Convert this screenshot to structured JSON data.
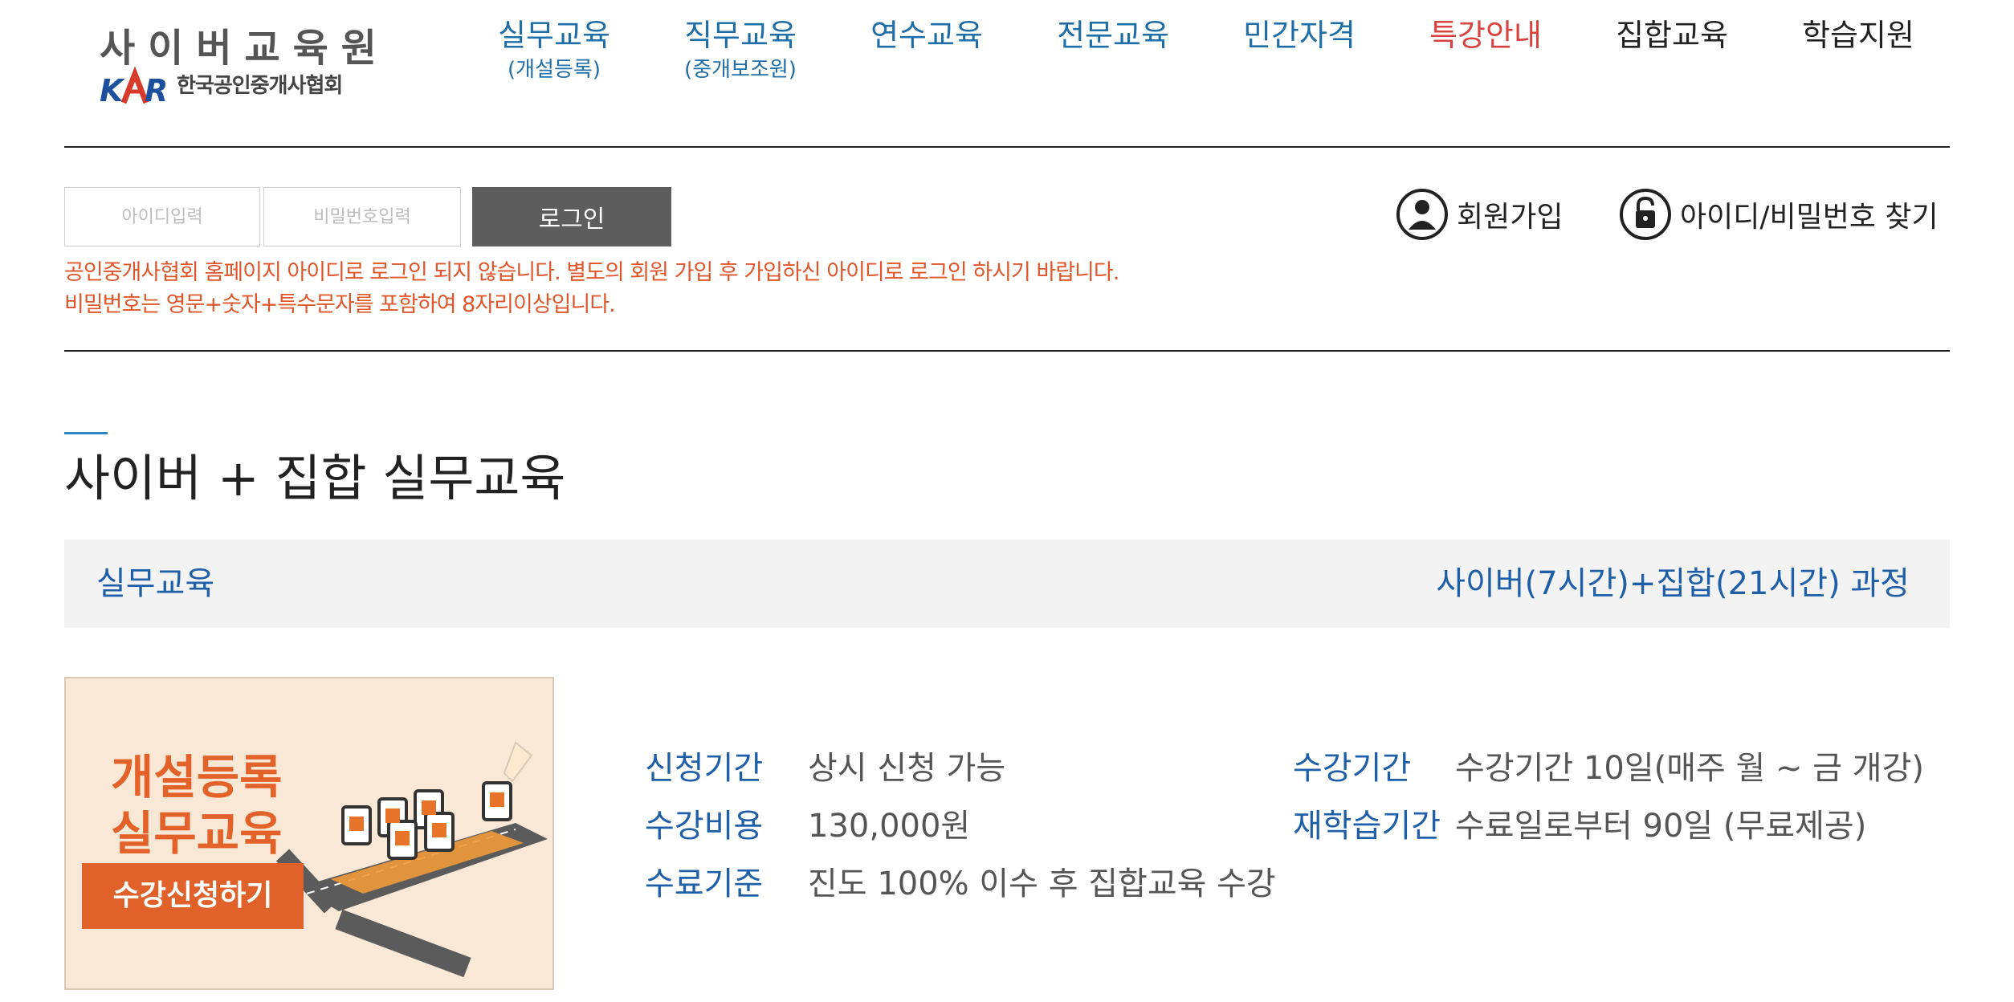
{
  "logo": {
    "title": "사이버교육원",
    "mark_text": "KAR",
    "org": "한국공인중개사협회"
  },
  "nav": [
    {
      "label": "실무교육",
      "sub": "(개설등록)",
      "color": "#1f6ea7"
    },
    {
      "label": "직무교육",
      "sub": "(중개보조원)",
      "color": "#1f6ea7"
    },
    {
      "label": "연수교육",
      "sub": "",
      "color": "#1f6ea7"
    },
    {
      "label": "전문교육",
      "sub": "",
      "color": "#1f6ea7"
    },
    {
      "label": "민간자격",
      "sub": "",
      "color": "#1f6ea7"
    },
    {
      "label": "특강안내",
      "sub": "",
      "color": "#d9433f"
    },
    {
      "label": "집합교육",
      "sub": "",
      "color": "#222222"
    },
    {
      "label": "학습지원",
      "sub": "",
      "color": "#222222"
    }
  ],
  "login": {
    "id_placeholder": "아이디입력",
    "pw_placeholder": "비밀번호입력",
    "button": "로그인",
    "notice_1": "공인중개사협회 홈페이지 아이디로 로그인 되지 않습니다. 별도의 회원 가입 후 가입하신 아이디로 로그인 하시기 바랍니다.",
    "notice_2": "비밀번호는 영문+숫자+특수문자를 포함하여 8자리이상입니다."
  },
  "util": {
    "signup": "회원가입",
    "find": "아이디/비밀번호 찾기"
  },
  "page_title": "사이버 + 집합 실무교육",
  "course": {
    "category": "실무교육",
    "name": "사이버(7시간)+집합(21시간) 과정"
  },
  "banner": {
    "line1": "개설등록",
    "line2": "실무교육",
    "button": "수강신청하기"
  },
  "info": {
    "apply_label": "신청기간",
    "apply_value": "상시 신청 가능",
    "fee_label": "수강비용",
    "fee_value": "130,000원",
    "complete_label": "수료기준",
    "complete_value": "진도 100% 이수 후 집합교육 수강",
    "period_label": "수강기간",
    "period_value": "수강기간 10일(매주 월 ~ 금 개강)",
    "relearn_label": "재학습기간",
    "relearn_value": "수료일로부터 90일 (무료제공)"
  },
  "colors": {
    "accent_blue": "#1f5fa8",
    "notice_orange": "#e0552a",
    "banner_orange": "#e1612a"
  }
}
